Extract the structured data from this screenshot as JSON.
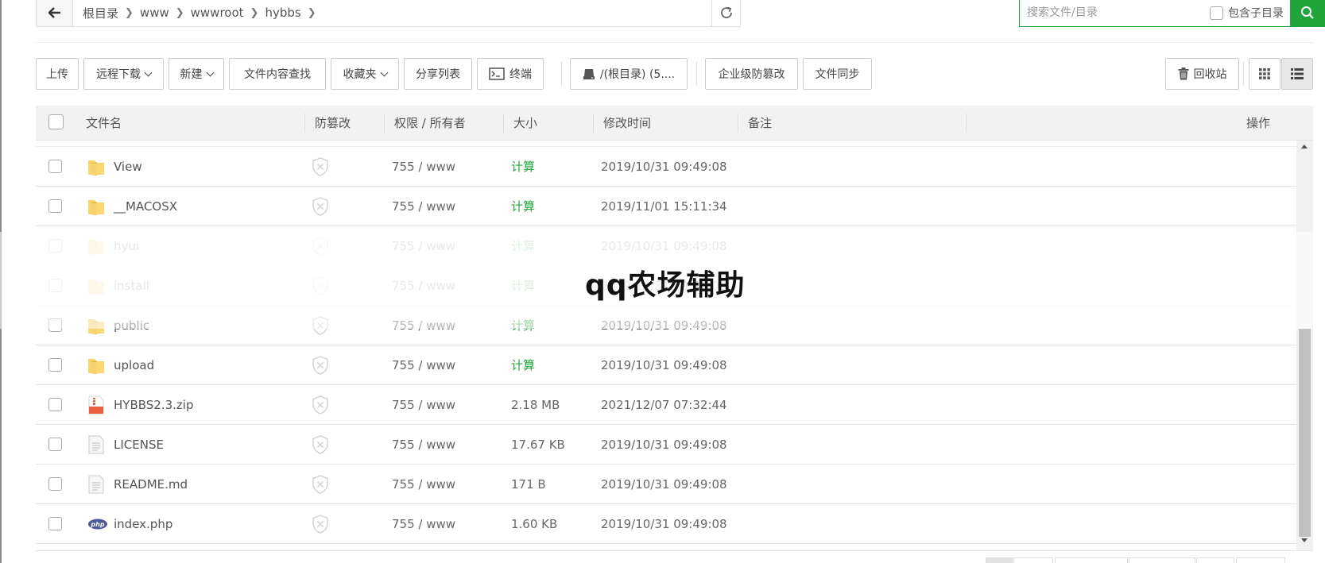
{
  "breadcrumb": {
    "items": [
      "根目录",
      "www",
      "wwwroot",
      "hybbs"
    ]
  },
  "search": {
    "placeholder": "搜索文件/目录",
    "include_sub_label": "包含子目录",
    "include_sub_checked": false
  },
  "toolbar": {
    "upload": "上传",
    "remote_download": "远程下载",
    "new": "新建",
    "content_search": "文件内容查找",
    "favorites": "收藏夹",
    "share_list": "分享列表",
    "terminal": "终端",
    "disk": "/(根目录) (5....",
    "tamper_proof_enterprise": "企业级防篡改",
    "file_sync": "文件同步",
    "recycle_bin": "回收站"
  },
  "table": {
    "headers": {
      "name": "文件名",
      "tamper": "防篡改",
      "perm": "权限 / 所有者",
      "size": "大小",
      "mtime": "修改时间",
      "note": "备注",
      "ops": "操作"
    },
    "rows": [
      {
        "name": "View",
        "type": "folder",
        "perm": "755 / www",
        "size": "计算",
        "mtime": "2019/10/31 09:49:08"
      },
      {
        "name": "__MACOSX",
        "type": "folder",
        "perm": "755 / www",
        "size": "计算",
        "mtime": "2019/11/01 15:11:34"
      },
      {
        "name": "hyui",
        "type": "folder",
        "perm": "755 / www",
        "size": "计算",
        "mtime": "2019/10/31 09:49:08"
      },
      {
        "name": "install",
        "type": "folder",
        "perm": "755 / www",
        "size": "计算",
        "mtime": "2019/10/31 09:49:08"
      },
      {
        "name": "public",
        "type": "folder",
        "perm": "755 / www",
        "size": "计算",
        "mtime": "2019/10/31 09:49:08"
      },
      {
        "name": "upload",
        "type": "folder",
        "perm": "755 / www",
        "size": "计算",
        "mtime": "2019/10/31 09:49:08"
      },
      {
        "name": "HYBBS2.3.zip",
        "type": "zip",
        "perm": "755 / www",
        "size": "2.18 MB",
        "mtime": "2021/12/07 07:32:44"
      },
      {
        "name": "LICENSE",
        "type": "file",
        "perm": "755 / www",
        "size": "17.67 KB",
        "mtime": "2019/10/31 09:49:08"
      },
      {
        "name": "README.md",
        "type": "file",
        "perm": "755 / www",
        "size": "171 B",
        "mtime": "2019/10/31 09:49:08"
      },
      {
        "name": "index.php",
        "type": "php",
        "perm": "755 / www",
        "size": "1.60 KB",
        "mtime": "2019/10/31 09:49:08"
      }
    ]
  },
  "overlay": {
    "text": "qq农场辅助"
  },
  "colors": {
    "accent": "#20a53a"
  }
}
